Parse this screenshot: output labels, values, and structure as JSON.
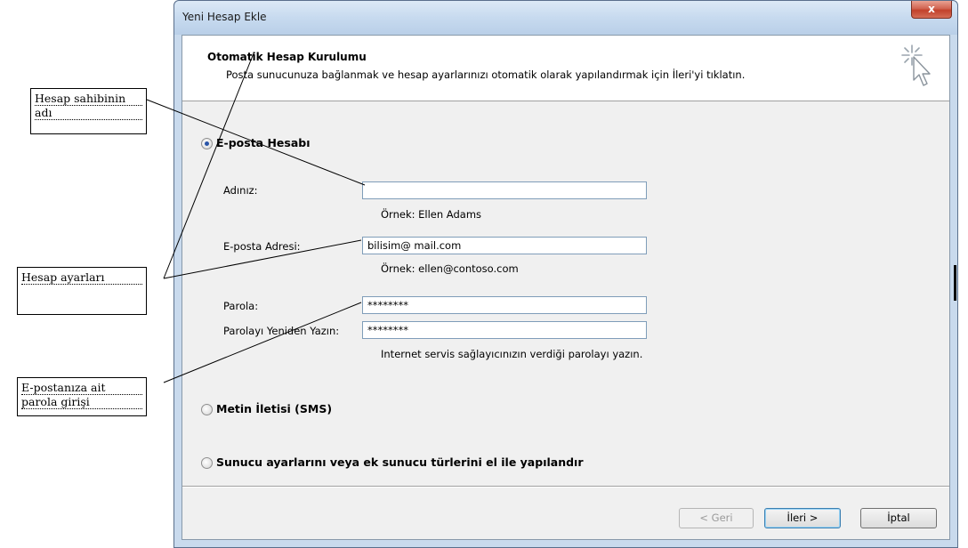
{
  "window": {
    "title": "Yeni Hesap Ekle",
    "close_label": "x"
  },
  "header": {
    "title": "Otomatik Hesap Kurulumu",
    "subtitle": "Posta sunucunuza bağlanmak ve hesap ayarlarınızı otomatik olarak yapılandırmak için İleri'yi tıklatın.",
    "icon": "wizard-cursor-icon"
  },
  "options": {
    "email_account": "E-posta Hesabı",
    "sms": "Metin İletisi (SMS)",
    "manual": "Sunucu ayarlarını veya ek sunucu türlerini el ile yapılandır"
  },
  "form": {
    "name_label": "Adınız:",
    "name_value": "",
    "name_hint": "Örnek: Ellen Adams",
    "email_label": "E-posta Adresi:",
    "email_value": "bilisim@ mail.com",
    "email_hint": "Örnek: ellen@contoso.com",
    "password_label": "Parola:",
    "password_value": "********",
    "password_retype_label": "Parolayı Yeniden Yazın:",
    "password_retype_value": "********",
    "password_hint": "Internet servis sağlayıcınızın verdiği parolayı yazın."
  },
  "buttons": {
    "back": "< Geri",
    "next": "İleri >",
    "cancel": "İptal"
  },
  "annotations": {
    "owner_name": [
      "Hesap sahibinin",
      "adı"
    ],
    "account_settings": "Hesap ayarları",
    "password_entry": [
      "E-postanıza ait",
      "parola girişi"
    ]
  },
  "colors": {
    "frame": "#c9daed",
    "client": "#f0f0f0",
    "radio_dot": "#2a55a8"
  }
}
